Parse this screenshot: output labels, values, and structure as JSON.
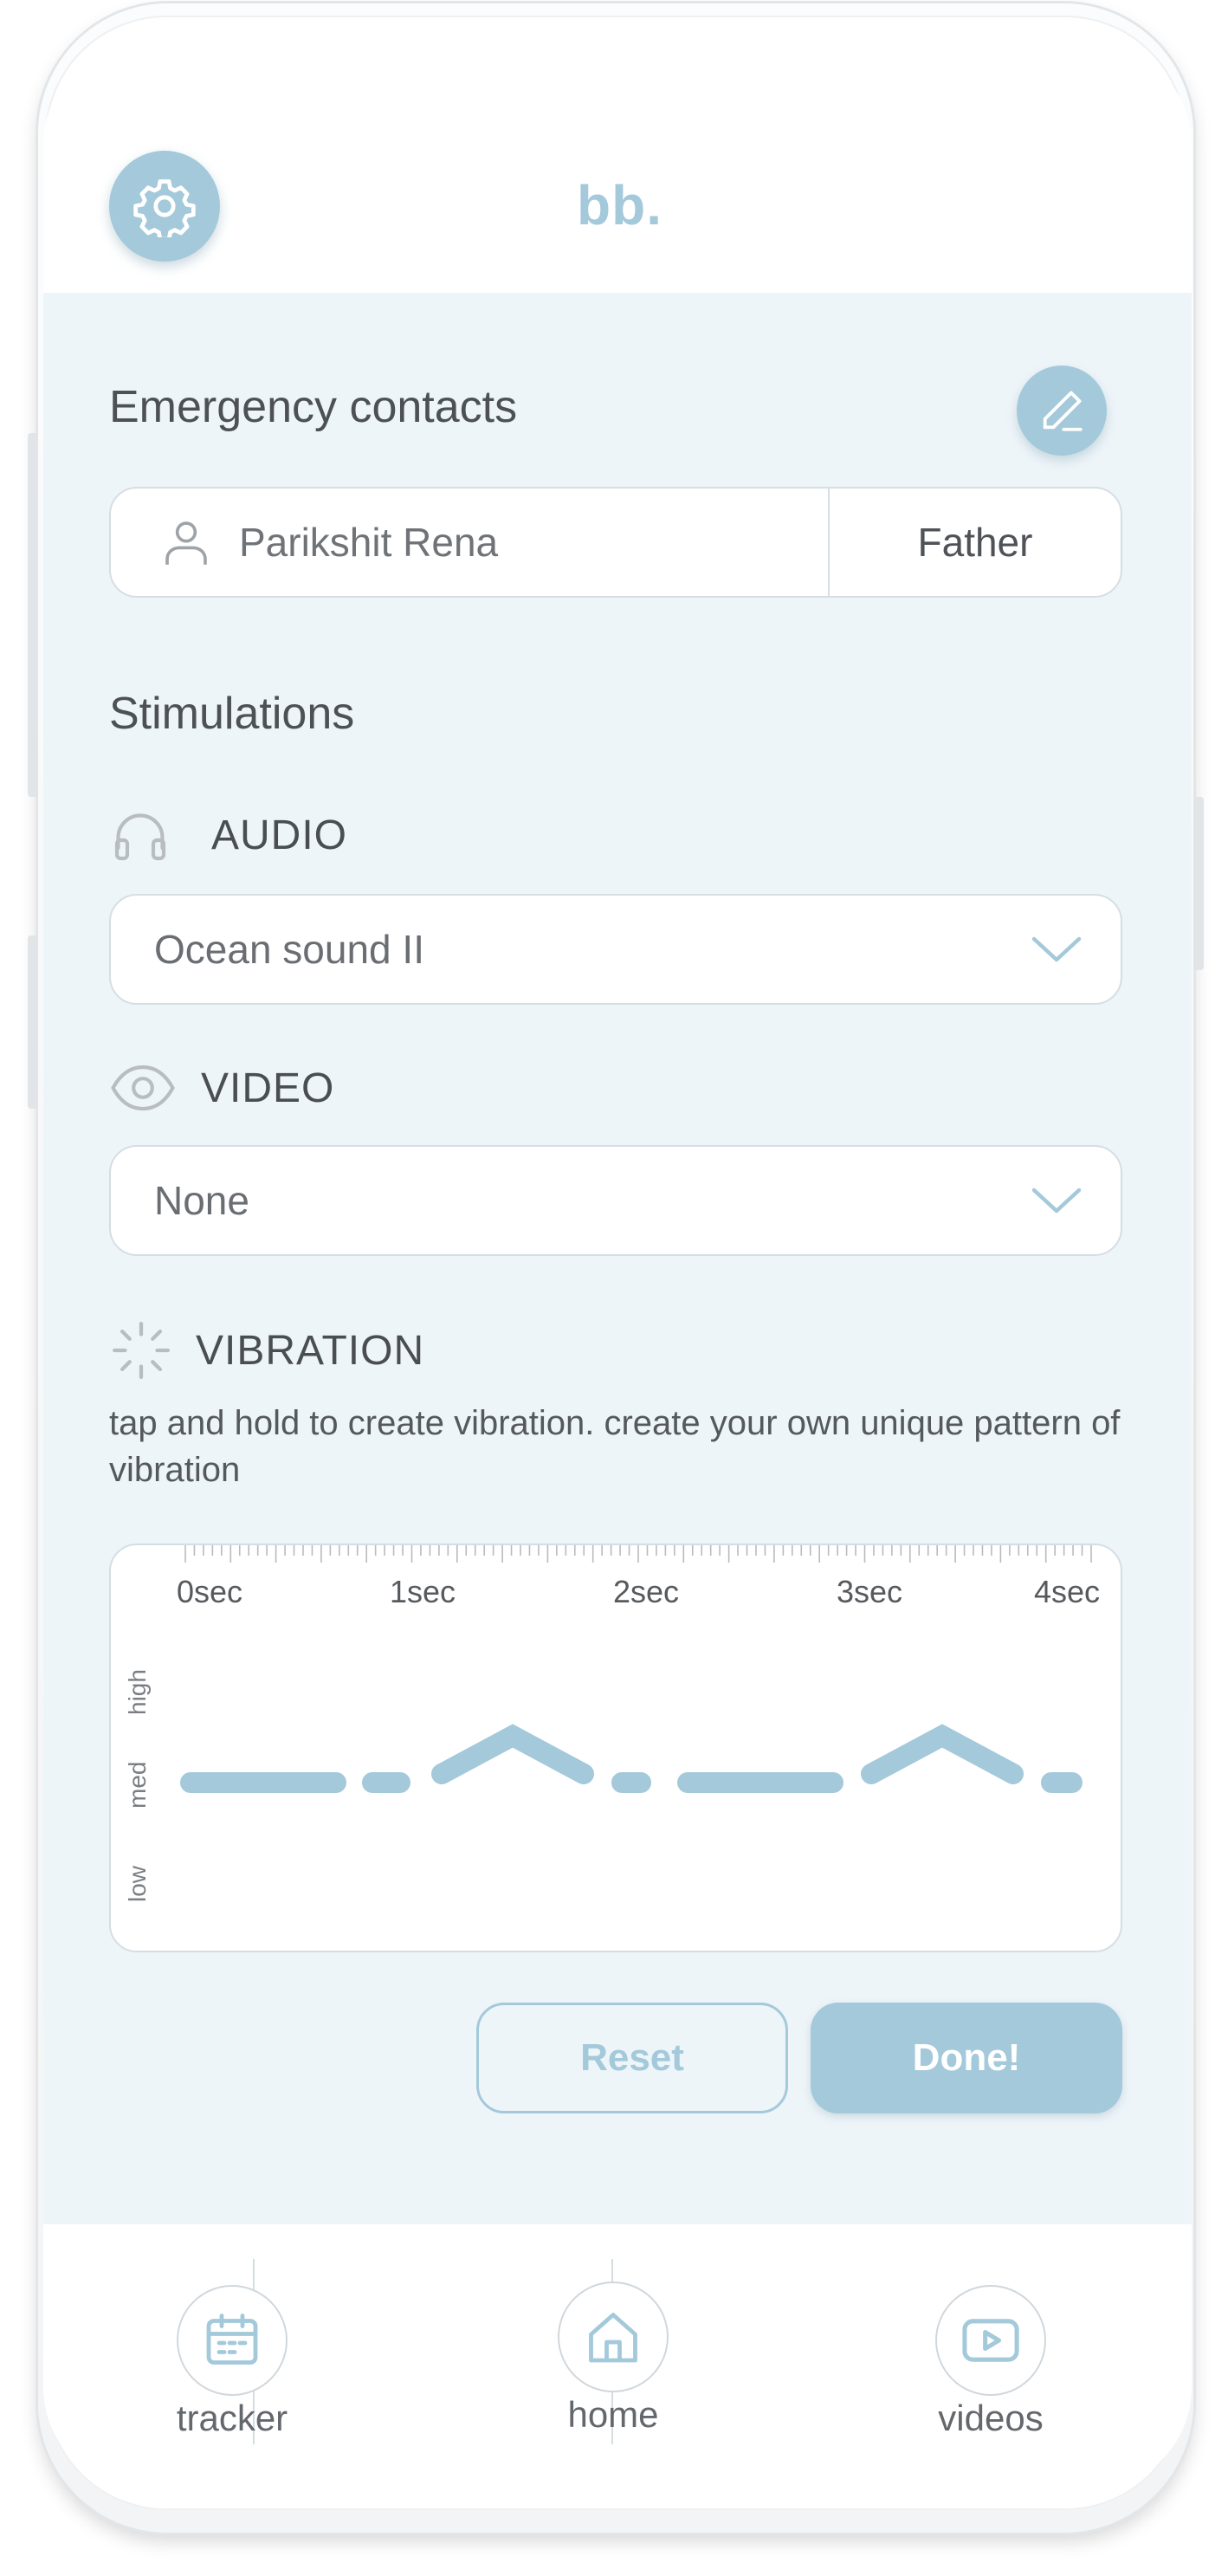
{
  "header": {
    "logo": "bb."
  },
  "emergency": {
    "title": "Emergency contacts",
    "contact_name": "Parikshit Rena",
    "contact_relation": "Father"
  },
  "stimulations": {
    "title": "Stimulations",
    "audio": {
      "label": "AUDIO",
      "selected": "Ocean sound II"
    },
    "video": {
      "label": "VIDEO",
      "selected": "None"
    },
    "vibration": {
      "label": "VIBRATION",
      "help": "tap and hold to create vibration. create your own unique pattern of vibration",
      "time_labels": [
        "0sec",
        "1sec",
        "2sec",
        "3sec",
        "4sec"
      ],
      "level_labels": [
        "high",
        "med",
        "low"
      ]
    }
  },
  "actions": {
    "reset": "Reset",
    "done": "Done!"
  },
  "nav": {
    "tracker": "tracker",
    "home": "home",
    "videos": "videos"
  },
  "colors": {
    "accent": "#a3c9da",
    "background": "#eef5f9",
    "text": "#4d5156"
  },
  "icons": [
    "gear-icon",
    "pencil-icon",
    "user-icon",
    "headphones-icon",
    "eye-icon",
    "vibration-icon",
    "chevron-down-icon",
    "calendar-icon",
    "home-icon",
    "play-icon"
  ]
}
